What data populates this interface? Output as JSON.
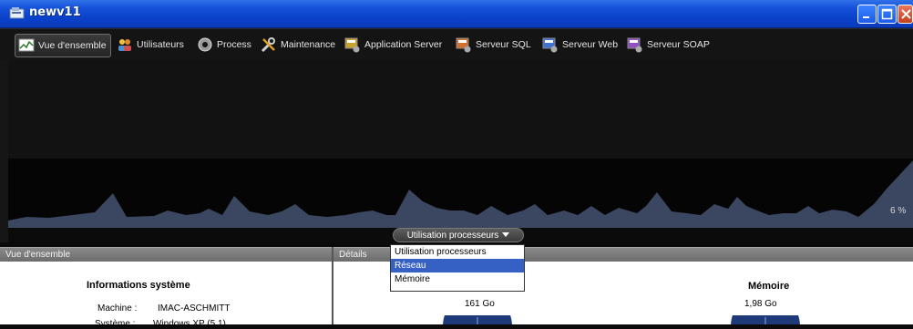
{
  "window": {
    "title": "newv11"
  },
  "toolbar": {
    "items": [
      {
        "label": "Vue d'ensemble",
        "icon": "chart-icon",
        "active": true
      },
      {
        "label": "Utilisateurs",
        "icon": "users-icon",
        "active": false
      },
      {
        "label": "Process",
        "icon": "gear-icon",
        "active": false
      },
      {
        "label": "Maintenance",
        "icon": "tools-icon",
        "active": false
      },
      {
        "label": "Application Server",
        "icon": "app-server-icon",
        "active": false
      },
      {
        "label": "Serveur SQL",
        "icon": "sql-server-icon",
        "active": false
      },
      {
        "label": "Serveur Web",
        "icon": "web-server-icon",
        "active": false
      },
      {
        "label": "Serveur SOAP",
        "icon": "soap-server-icon",
        "active": false
      }
    ]
  },
  "chart": {
    "current_value": "6 %",
    "selector_label": "Utilisation processeurs",
    "fill_color": "#3b4660"
  },
  "menu": {
    "options": [
      "Utilisation processeurs",
      "Réseau",
      "Mémoire"
    ],
    "selected_index": 1
  },
  "panels": {
    "left_header": "Vue d'ensemble",
    "right_header": "Détails"
  },
  "system_info": {
    "title": "Informations système",
    "machine_label": "Machine :",
    "machine_value": "IMAC-ASCHMITT",
    "system_label": "Système :",
    "system_value": "Windows XP (5.1)"
  },
  "gauges": {
    "disk_value": "161 Go",
    "memory_title": "Mémoire",
    "memory_value": "1,98 Go"
  }
}
